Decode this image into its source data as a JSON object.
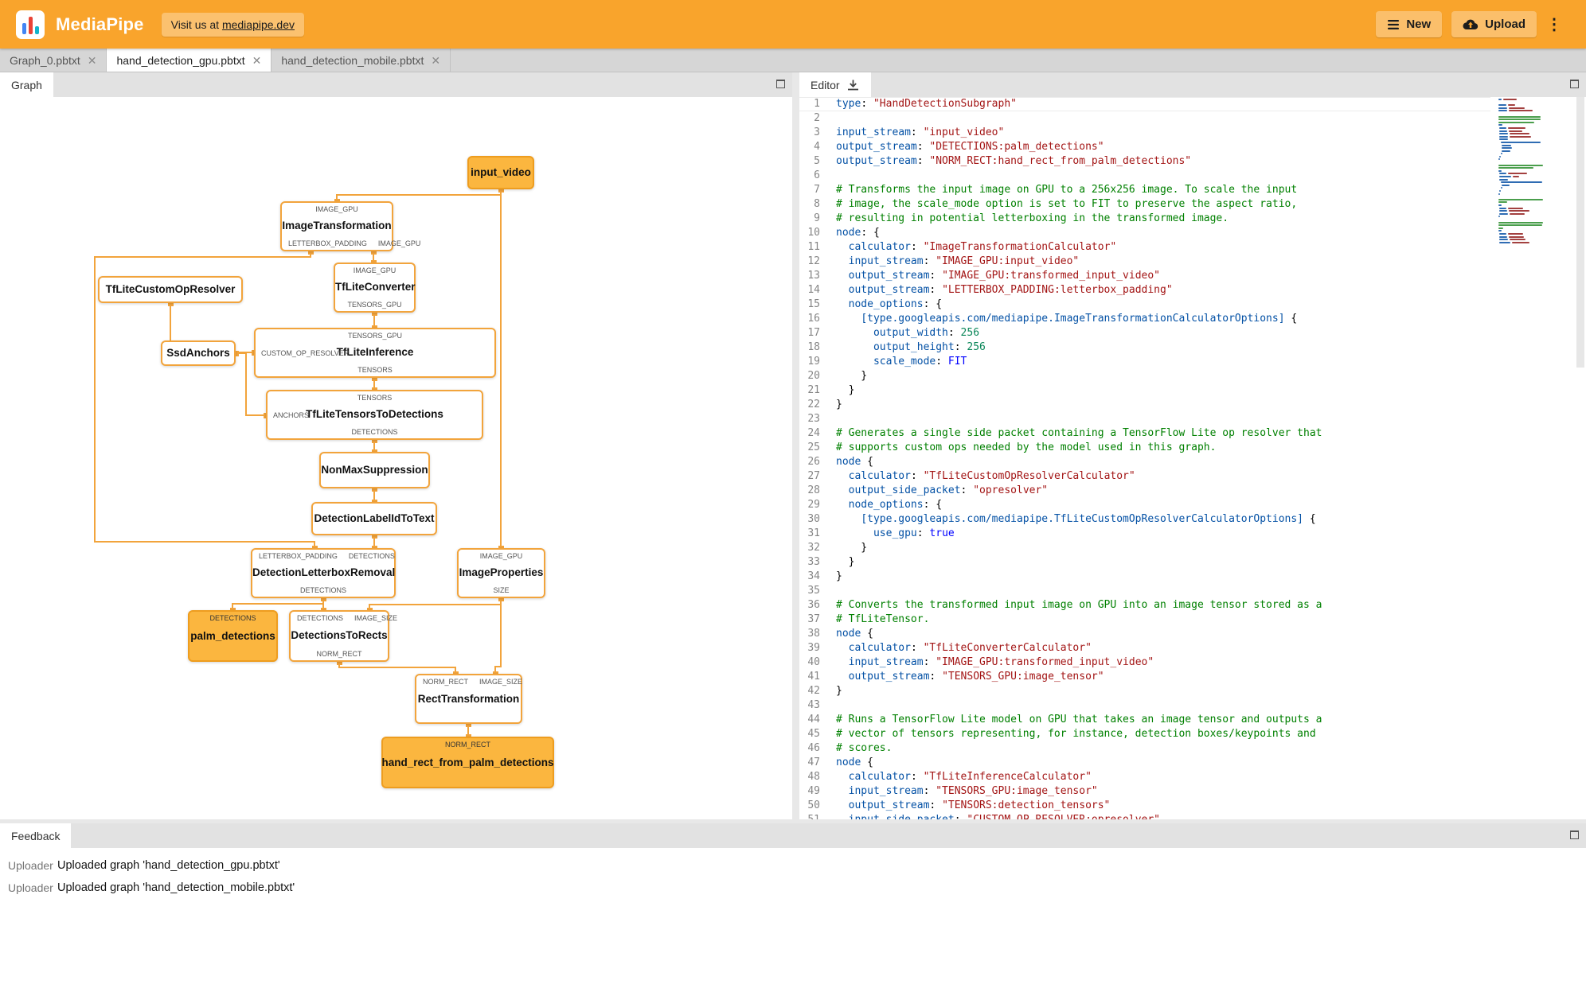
{
  "header": {
    "title": "MediaPipe",
    "visit_prefix": "Visit us at ",
    "visit_link": "mediapipe.dev",
    "new_label": "New",
    "upload_label": "Upload"
  },
  "file_tabs": [
    {
      "label": "Graph_0.pbtxt",
      "close": "✕",
      "active": false
    },
    {
      "label": "hand_detection_gpu.pbtxt",
      "close": "✕",
      "active": true
    },
    {
      "label": "hand_detection_mobile.pbtxt",
      "close": "✕",
      "active": false
    }
  ],
  "panels": {
    "graph_tab": "Graph",
    "editor_tab": "Editor",
    "feedback_tab": "Feedback"
  },
  "colors": {
    "accent": "#F9A42C",
    "node_fill": "#FBB63F",
    "edge": "#F2A43C"
  },
  "graph": {
    "nodes": [
      {
        "label": "input_video",
        "type": "stream"
      },
      {
        "label": "ImageTransformation",
        "ports_top": [
          "IMAGE_GPU"
        ],
        "ports_bottom": [
          "LETTERBOX_PADDING",
          "IMAGE_GPU"
        ]
      },
      {
        "label": "TfLiteConverter",
        "ports_top": [
          "IMAGE_GPU"
        ],
        "ports_bottom": [
          "TENSORS_GPU"
        ]
      },
      {
        "label": "TfLiteCustomOpResolver"
      },
      {
        "label": "SsdAnchors"
      },
      {
        "label": "TfLiteInference",
        "ports_top": [
          "TENSORS_GPU"
        ],
        "port_left": "CUSTOM_OP_RESOLVER",
        "ports_bottom": [
          "TENSORS"
        ]
      },
      {
        "label": "TfLiteTensorsToDetections",
        "ports_top": [
          "TENSORS"
        ],
        "port_left": "ANCHORS",
        "ports_bottom": [
          "DETECTIONS"
        ]
      },
      {
        "label": "NonMaxSuppression"
      },
      {
        "label": "DetectionLabelIdToText"
      },
      {
        "label": "DetectionLetterboxRemoval",
        "ports_top": [
          "LETTERBOX_PADDING",
          "DETECTIONS"
        ],
        "ports_bottom": [
          "DETECTIONS"
        ]
      },
      {
        "label": "ImageProperties",
        "ports_top": [
          "IMAGE_GPU"
        ],
        "ports_bottom": [
          "SIZE"
        ]
      },
      {
        "label": "palm_detections",
        "type": "stream",
        "ports_top": [
          "DETECTIONS"
        ]
      },
      {
        "label": "DetectionsToRects",
        "ports_top": [
          "DETECTIONS",
          "IMAGE_SIZE"
        ],
        "ports_bottom": [
          "NORM_RECT"
        ]
      },
      {
        "label": "RectTransformation",
        "ports_top": [
          "NORM_RECT",
          "IMAGE_SIZE"
        ]
      },
      {
        "label": "hand_rect_from_palm_detections",
        "type": "stream",
        "ports_top": [
          "NORM_RECT"
        ]
      }
    ]
  },
  "editor": {
    "lines": [
      "type: \"HandDetectionSubgraph\"",
      "",
      "input_stream: \"input_video\"",
      "output_stream: \"DETECTIONS:palm_detections\"",
      "output_stream: \"NORM_RECT:hand_rect_from_palm_detections\"",
      "",
      "# Transforms the input image on GPU to a 256x256 image. To scale the input",
      "# image, the scale_mode option is set to FIT to preserve the aspect ratio,",
      "# resulting in potential letterboxing in the transformed image.",
      "node: {",
      "  calculator: \"ImageTransformationCalculator\"",
      "  input_stream: \"IMAGE_GPU:input_video\"",
      "  output_stream: \"IMAGE_GPU:transformed_input_video\"",
      "  output_stream: \"LETTERBOX_PADDING:letterbox_padding\"",
      "  node_options: {",
      "    [type.googleapis.com/mediapipe.ImageTransformationCalculatorOptions] {",
      "      output_width: 256",
      "      output_height: 256",
      "      scale_mode: FIT",
      "    }",
      "  }",
      "}",
      "",
      "# Generates a single side packet containing a TensorFlow Lite op resolver that",
      "# supports custom ops needed by the model used in this graph.",
      "node {",
      "  calculator: \"TfLiteCustomOpResolverCalculator\"",
      "  output_side_packet: \"opresolver\"",
      "  node_options: {",
      "    [type.googleapis.com/mediapipe.TfLiteCustomOpResolverCalculatorOptions] {",
      "      use_gpu: true",
      "    }",
      "  }",
      "}",
      "",
      "# Converts the transformed input image on GPU into an image tensor stored as a",
      "# TfLiteTensor.",
      "node {",
      "  calculator: \"TfLiteConverterCalculator\"",
      "  input_stream: \"IMAGE_GPU:transformed_input_video\"",
      "  output_stream: \"TENSORS_GPU:image_tensor\"",
      "}",
      "",
      "# Runs a TensorFlow Lite model on GPU that takes an image tensor and outputs a",
      "# vector of tensors representing, for instance, detection boxes/keypoints and",
      "# scores.",
      "node {",
      "  calculator: \"TfLiteInferenceCalculator\"",
      "  input_stream: \"TENSORS_GPU:image_tensor\"",
      "  output_stream: \"TENSORS:detection_tensors\"",
      "  input_side_packet: \"CUSTOM_OP_RESOLVER:opresolver\""
    ]
  },
  "feedback": {
    "rows": [
      {
        "source": "Uploader",
        "message": "Uploaded graph 'hand_detection_gpu.pbtxt'"
      },
      {
        "source": "Uploader",
        "message": "Uploaded graph 'hand_detection_mobile.pbtxt'"
      }
    ]
  }
}
